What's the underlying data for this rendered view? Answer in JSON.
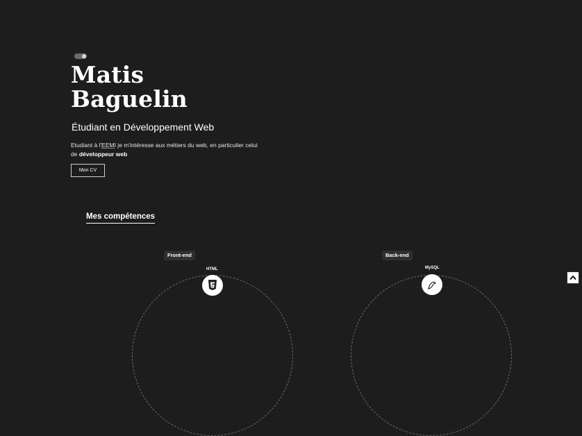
{
  "hero": {
    "first_name": "Matis",
    "last_name": "Baguelin",
    "subtitle": "Étudiant en Développement Web",
    "intro_prefix": "Etudiant à l'",
    "intro_abbr": "EEMI",
    "intro_middle": " je m'intéresse aux métiers du web, en particulier celui de ",
    "intro_bold": "développeur web",
    "cv_button": "Mon CV"
  },
  "skills": {
    "title": "Mes compétences",
    "groups": [
      {
        "label": "Front-end",
        "featured": "HTML",
        "icon": "html5-icon"
      },
      {
        "label": "Back-end",
        "featured": "MySQL",
        "icon": "mysql-icon"
      }
    ]
  },
  "icons": {
    "toggle": "theme-toggle",
    "scroll_top": "chevron-up-icon"
  }
}
